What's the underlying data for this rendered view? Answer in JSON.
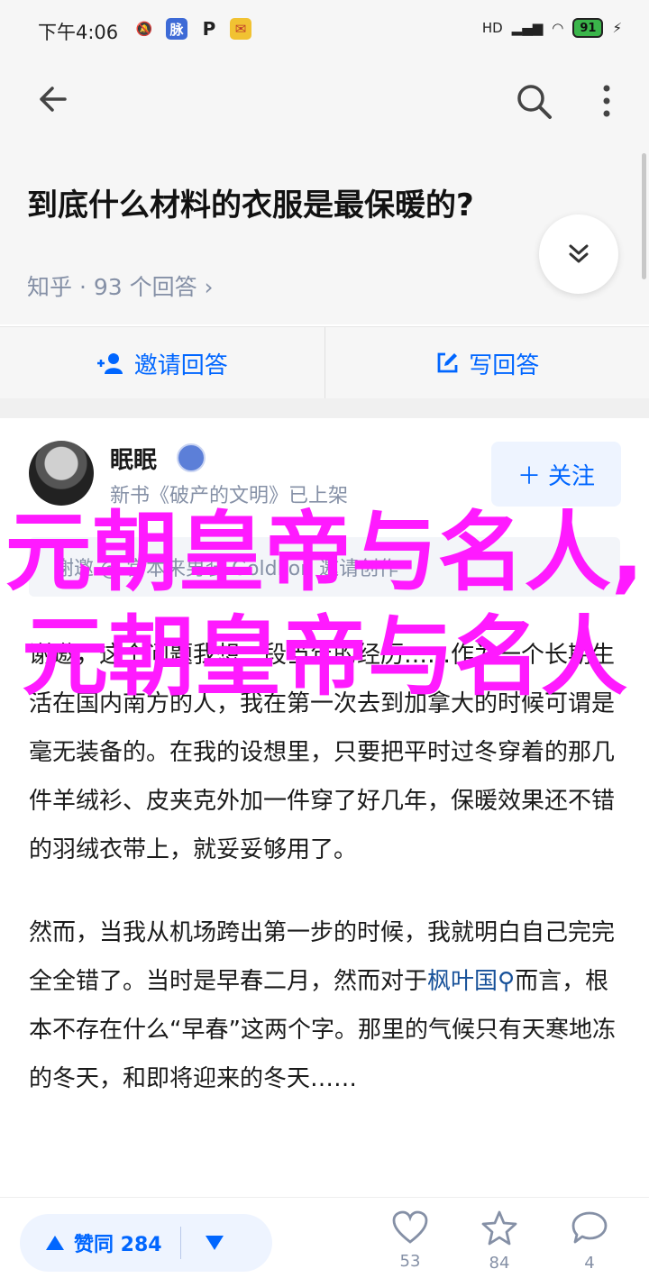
{
  "status_bar": {
    "time": "下午4:06",
    "icons": [
      "mute-bell-icon",
      "chinese-app-icon",
      "p-icon",
      "email-icon"
    ],
    "app_badge_char": "脉",
    "p_char": "P",
    "signal_text": "HD",
    "battery_level": "91"
  },
  "question": {
    "title": "到底什么材料的衣服是最保暖的?",
    "meta": "知乎 · 93 个回答 ›"
  },
  "actions": {
    "invite_label": "邀请回答",
    "write_label": "写回答"
  },
  "answer": {
    "author": "眠眠",
    "subline": "新书《破产的文明》已上架",
    "follow_label": "关注",
    "invited_line": "谢邀 @ 宫本来男装 Goldlion 邀请创作",
    "paragraph1": "谢邀，这个问题我想一段当年的经历……作为一个长期生活在国内南方的人，我在第一次去到加拿大的时候可谓是毫无装备的。在我的设想里，只要把平时过冬穿着的那几件羊绒衫、皮夹克外加一件穿了好几年，保暖效果还不错的羽绒衣带上，就妥妥够用了。",
    "paragraph2_start": "然而，当我从机场跨出第一步的时候，我就明白自己完完全全错了。当时是早春二月，然而对于",
    "paragraph2_link": "枫叶国",
    "paragraph2_end": "而言，根本不存在什么“早春”这两个字。那里的气候只有天寒地冻的冬天，和即将迎来的冬天……"
  },
  "overlay_text": "元朝皇帝与名人,元朝皇帝与名人",
  "bottom": {
    "vote_label": "赞同 284",
    "like_count": "53",
    "favorite_count": "84",
    "comment_count": "4"
  },
  "colors": {
    "accent": "#0066ff",
    "overlay": "#ff1aff",
    "muted": "#8590a6"
  }
}
